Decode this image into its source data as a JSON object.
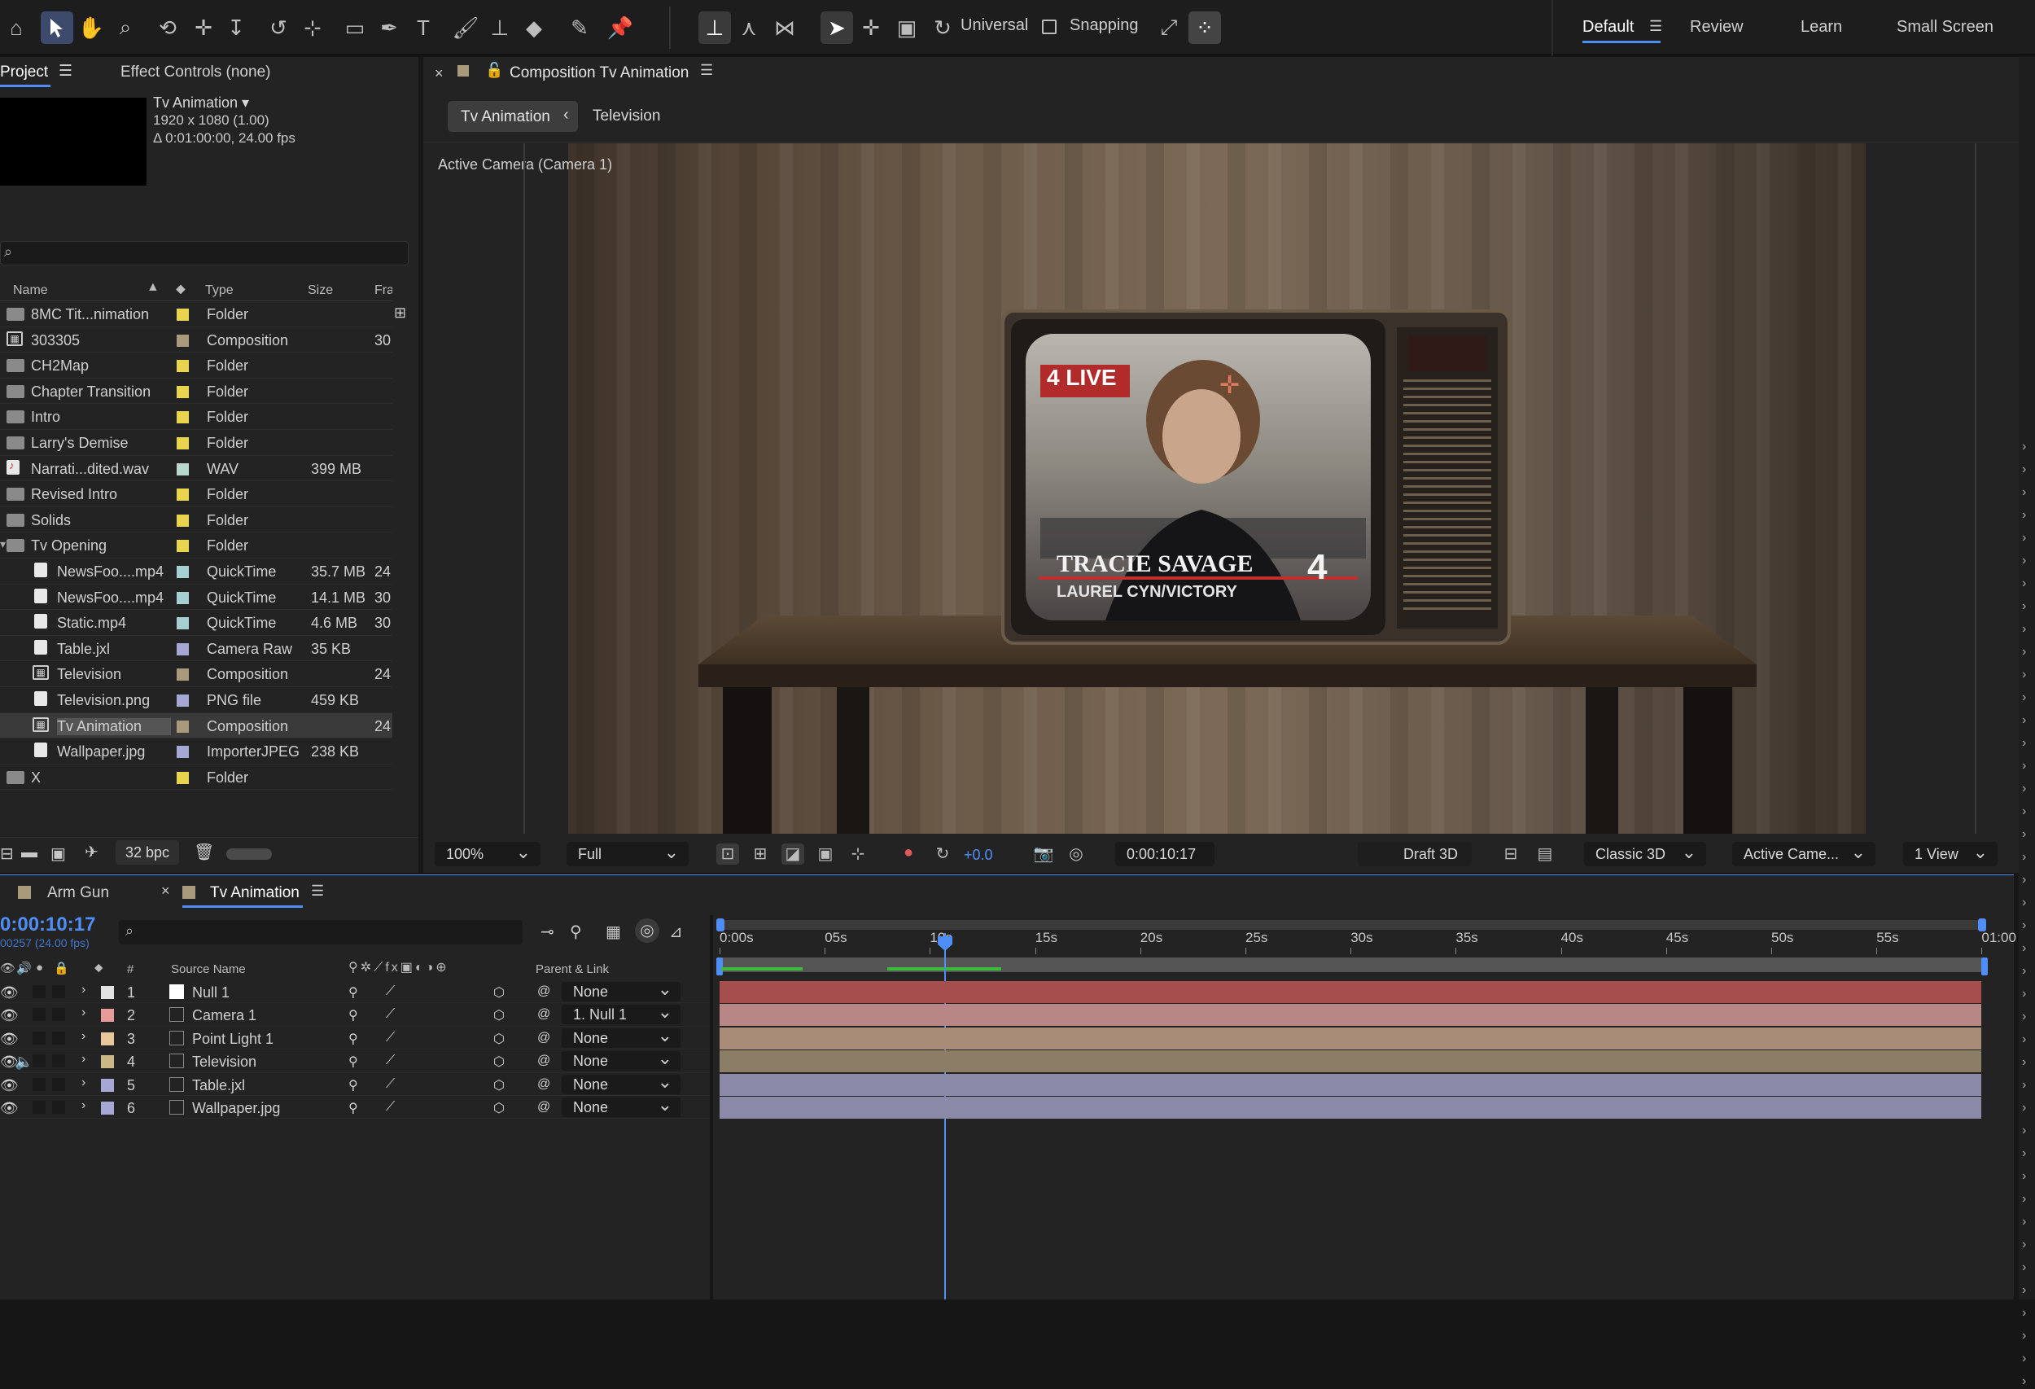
{
  "toolbar": {
    "universal_label": "Universal",
    "snapping_label": "Snapping",
    "workspaces": [
      "Default",
      "Review",
      "Learn",
      "Small Screen"
    ]
  },
  "project_panel": {
    "tab_project": "Project",
    "tab_effect_controls": "Effect Controls (none)",
    "comp_name": "Tv Animation ▾",
    "comp_size": "1920 x 1080 (1.00)",
    "comp_duration": "Δ 0:01:00:00, 24.00 fps",
    "columns": {
      "name": "Name",
      "type": "Type",
      "size": "Size",
      "frame": "Frame R"
    },
    "items": [
      {
        "name": "8MC Tit...nimation",
        "type": "Folder",
        "size": "",
        "frame": "",
        "color": "#e8d44d",
        "kind": "folder",
        "indent": 0
      },
      {
        "name": "303305",
        "type": "Composition",
        "size": "",
        "frame": "30",
        "color": "#a89a7a",
        "kind": "comp",
        "indent": 0
      },
      {
        "name": "CH2Map",
        "type": "Folder",
        "size": "",
        "frame": "",
        "color": "#e8d44d",
        "kind": "folder",
        "indent": 0
      },
      {
        "name": "Chapter Transition",
        "type": "Folder",
        "size": "",
        "frame": "",
        "color": "#e8d44d",
        "kind": "folder",
        "indent": 0
      },
      {
        "name": "Intro",
        "type": "Folder",
        "size": "",
        "frame": "",
        "color": "#e8d44d",
        "kind": "folder",
        "indent": 0
      },
      {
        "name": "Larry's Demise",
        "type": "Folder",
        "size": "",
        "frame": "",
        "color": "#e8d44d",
        "kind": "folder",
        "indent": 0
      },
      {
        "name": "Narrati...dited.wav",
        "type": "WAV",
        "size": "399 MB",
        "frame": "",
        "color": "#b7d7cf",
        "kind": "audio",
        "indent": 0
      },
      {
        "name": "Revised Intro",
        "type": "Folder",
        "size": "",
        "frame": "",
        "color": "#e8d44d",
        "kind": "folder",
        "indent": 0
      },
      {
        "name": "Solids",
        "type": "Folder",
        "size": "",
        "frame": "",
        "color": "#e8d44d",
        "kind": "folder",
        "indent": 0
      },
      {
        "name": "Tv Opening",
        "type": "Folder",
        "size": "",
        "frame": "",
        "color": "#e8d44d",
        "kind": "folder",
        "indent": 0
      },
      {
        "name": "NewsFoo....mp4",
        "type": "QuickTime",
        "size": "35.7 MB",
        "frame": "24",
        "color": "#a6cfd0",
        "kind": "file",
        "indent": 1
      },
      {
        "name": "NewsFoo....mp4",
        "type": "QuickTime",
        "size": "14.1 MB",
        "frame": "30",
        "color": "#a6cfd0",
        "kind": "file",
        "indent": 1
      },
      {
        "name": "Static.mp4",
        "type": "QuickTime",
        "size": "4.6 MB",
        "frame": "30",
        "color": "#a6cfd0",
        "kind": "file",
        "indent": 1
      },
      {
        "name": "Table.jxl",
        "type": "Camera Raw",
        "size": "35 KB",
        "frame": "",
        "color": "#a7a7d6",
        "kind": "file",
        "indent": 1
      },
      {
        "name": "Television",
        "type": "Composition",
        "size": "",
        "frame": "24",
        "color": "#a89a7a",
        "kind": "comp",
        "indent": 1
      },
      {
        "name": "Television.png",
        "type": "PNG file",
        "size": "459 KB",
        "frame": "",
        "color": "#a7a7d6",
        "kind": "file",
        "indent": 1
      },
      {
        "name": "Tv Animation",
        "type": "Composition",
        "size": "",
        "frame": "24",
        "color": "#a89a7a",
        "kind": "comp",
        "indent": 1,
        "selected": true
      },
      {
        "name": "Wallpaper.jpg",
        "type": "ImporterJPEG",
        "size": "238 KB",
        "frame": "",
        "color": "#a7a7d6",
        "kind": "file",
        "indent": 1
      },
      {
        "name": "X",
        "type": "Folder",
        "size": "",
        "frame": "",
        "color": "#e8d44d",
        "kind": "folder",
        "indent": 0
      }
    ],
    "bpc": "32 bpc"
  },
  "viewer": {
    "tab_title": "Composition Tv Animation",
    "crumb_active": "Tv Animation",
    "crumb_next": "Television",
    "camera_label": "Active Camera (Camera 1)",
    "tv_live": "4 LIVE",
    "tv_name": "TRACIE SAVAGE",
    "tv_location": "LAUREL CYN/VICTORY",
    "tv_logo": "4",
    "zoom": "100%",
    "resolution": "Full",
    "exposure": "+0.0",
    "timecode": "0:00:10:17",
    "draft3d": "Draft 3D",
    "renderer": "Classic 3D",
    "camera_select": "Active Came...",
    "views": "1 View"
  },
  "timeline": {
    "tab_armgun": "Arm Gun",
    "tab_tv": "Tv Animation",
    "timecode": "0:00:10:17",
    "frames": "00257 (24.00 fps)",
    "col_num": "#",
    "col_source": "Source Name",
    "col_parent": "Parent & Link",
    "ruler": [
      "0:00s",
      "05s",
      "10s",
      "15s",
      "20s",
      "25s",
      "30s",
      "35s",
      "40s",
      "45s",
      "50s",
      "55s",
      "01:00"
    ],
    "layers": [
      {
        "num": "1",
        "name": "Null 1",
        "parent": "None",
        "label": "#e2e2e2",
        "bar": "#a64d4d"
      },
      {
        "num": "2",
        "name": "Camera 1",
        "parent": "1. Null 1",
        "label": "#e79a9a",
        "bar": "#b98686"
      },
      {
        "num": "3",
        "name": "Point Light 1",
        "parent": "None",
        "label": "#e8c79b",
        "bar": "#a98c78"
      },
      {
        "num": "4",
        "name": "Television",
        "parent": "None",
        "label": "#c9b78a",
        "bar": "#8c7d66"
      },
      {
        "num": "5",
        "name": "Table.jxl",
        "parent": "None",
        "label": "#a7a7d6",
        "bar": "#8a8aa8"
      },
      {
        "num": "6",
        "name": "Wallpaper.jpg",
        "parent": "None",
        "label": "#a7a7d6",
        "bar": "#8a8aa8"
      }
    ]
  },
  "colors": {
    "accent": "#4f8ef7",
    "panel": "#232323",
    "bg": "#161616"
  }
}
